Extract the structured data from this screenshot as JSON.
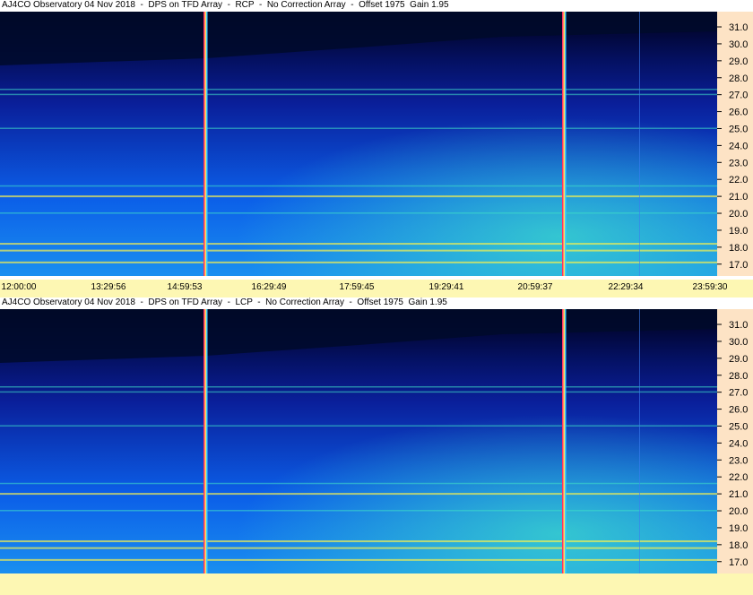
{
  "chart_data": [
    {
      "type": "heatmap",
      "title": "AJ4CO Observatory 04 Nov 2018  -  DPS on TFD Array  -  RCP  -  No Correction Array  -  Offset 1975  Gain 1.95",
      "y_ticks": [
        "31.0",
        "30.0",
        "29.0",
        "28.0",
        "27.0",
        "26.0",
        "25.0",
        "24.0",
        "23.0",
        "22.0",
        "21.0",
        "20.0",
        "19.0",
        "18.0",
        "17.0"
      ],
      "y_values": [
        31,
        30,
        29,
        28,
        27,
        26,
        25,
        24,
        23,
        22,
        21,
        20,
        19,
        18,
        17
      ],
      "ylim": [
        16.3,
        31.9
      ],
      "x_ticks": [
        "12:00:00",
        "13:29:56",
        "14:59:53",
        "16:29:49",
        "17:59:45",
        "19:29:41",
        "20:59:37",
        "22:29:34",
        "23:59:30"
      ],
      "bright_bands_mhz": [
        27.3,
        27.0,
        25.0,
        21.6,
        21.0,
        20.0,
        18.2,
        17.8,
        17.1
      ],
      "colors": {
        "background": "#0a1f9a",
        "low": "#000018",
        "mid": "#0b5ee8",
        "high": "#3fe0c8",
        "peak": "#f5f050",
        "marker": "#ff3366"
      }
    },
    {
      "type": "heatmap",
      "title": "AJ4CO Observatory 04 Nov 2018  -  DPS on TFD Array  -  LCP  -  No Correction Array  -  Offset 1975  Gain 1.95",
      "y_ticks": [
        "31.0",
        "30.0",
        "29.0",
        "28.0",
        "27.0",
        "26.0",
        "25.0",
        "24.0",
        "23.0",
        "22.0",
        "21.0",
        "20.0",
        "19.0",
        "18.0",
        "17.0"
      ],
      "y_values": [
        31,
        30,
        29,
        28,
        27,
        26,
        25,
        24,
        23,
        22,
        21,
        20,
        19,
        18,
        17
      ],
      "ylim": [
        16.3,
        31.9
      ],
      "x_ticks": [],
      "bright_bands_mhz": [
        27.3,
        27.0,
        25.0,
        21.6,
        21.0,
        20.0,
        18.2,
        17.8,
        17.1
      ],
      "colors": {
        "background": "#0a1f9a",
        "low": "#000018",
        "mid": "#0b5ee8",
        "high": "#3fe0c8",
        "peak": "#f5f050",
        "marker": "#ff3366"
      }
    }
  ]
}
